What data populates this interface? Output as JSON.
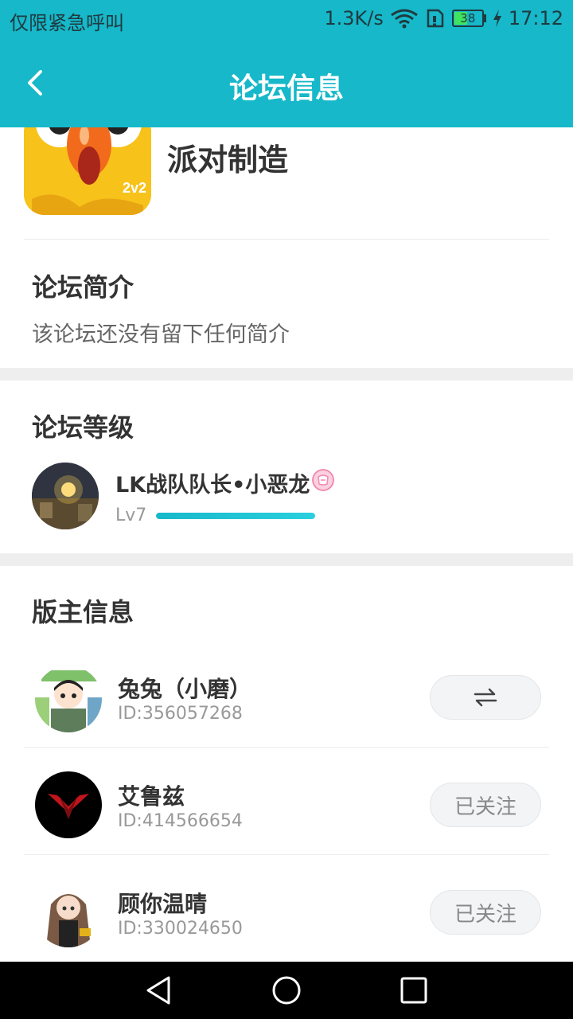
{
  "status_bar": {
    "carrier": "仅限紧急呼叫",
    "network_speed": "1.3K/s",
    "battery_level": "38",
    "time": "17:12",
    "icons": [
      "wifi-icon",
      "sim-icon",
      "battery-icon",
      "charging-icon"
    ]
  },
  "app_bar": {
    "title": "论坛信息",
    "back_icon": "chevron-left-icon"
  },
  "forum": {
    "name": "派对制造",
    "icon_badge": "2v2"
  },
  "intro": {
    "title": "论坛简介",
    "text": "该论坛还没有留下任何简介"
  },
  "level": {
    "title": "论坛等级",
    "user_name": "LK战队队长•小恶龙",
    "level_label": "Lv7",
    "progress": 1.0
  },
  "moderators": {
    "title": "版主信息",
    "items": [
      {
        "name": "兔兔（小磨）",
        "id": "ID:356057268",
        "button": "⇌",
        "button_icon": "swap-icon"
      },
      {
        "name": "艾鲁兹",
        "id": "ID:414566654",
        "button": "已关注"
      },
      {
        "name": "顾你温晴",
        "id": "ID:330024650",
        "button": "已关注"
      }
    ]
  },
  "colors": {
    "primary": "#16b8c9",
    "text_dark": "#333333",
    "text_muted": "#999999",
    "separator": "#eeeeee"
  }
}
